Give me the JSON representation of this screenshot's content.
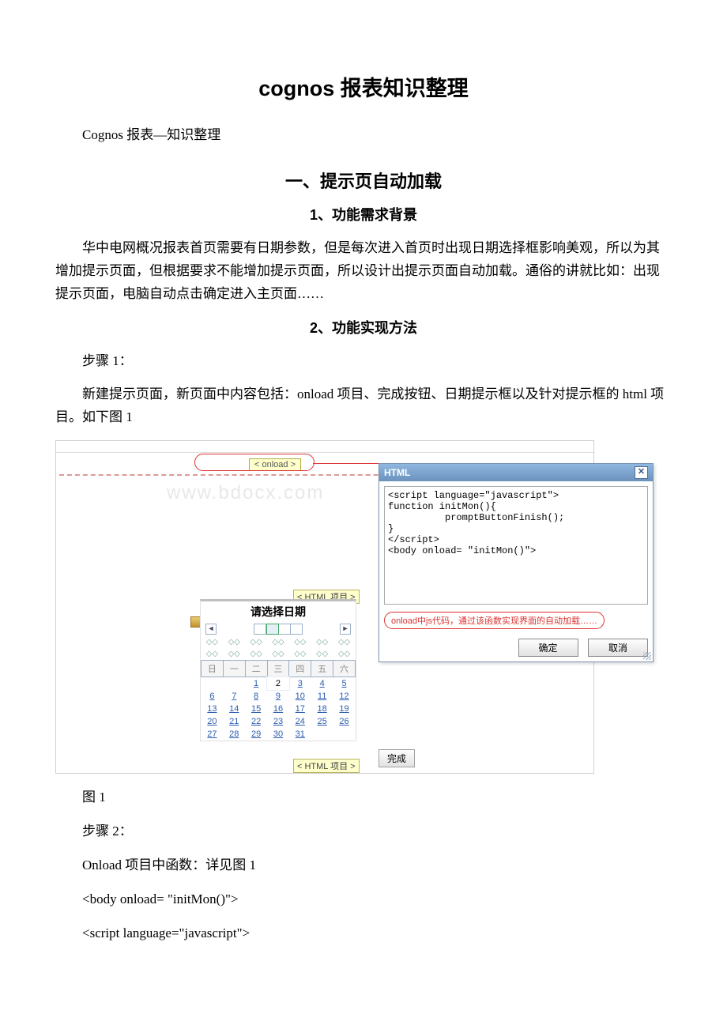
{
  "doc": {
    "title": "cognos 报表知识整理",
    "subtitle": "Cognos 报表—知识整理",
    "h1": "一、提示页自动加载",
    "s1_title": "1、功能需求背景",
    "s1_body": "华中电网概况报表首页需要有日期参数，但是每次进入首页时出现日期选择框影响美观，所以为其增加提示页面，但根据要求不能增加提示页面，所以设计出提示页面自动加载。通俗的讲就比如：出现提示页面，电脑自动点击确定进入主页面……",
    "s2_title": "2、功能实现方法",
    "step1_label": "步骤 1：",
    "step1_body": "新建提示页面，新页面中内容包括：onload 项目、完成按钮、日期提示框以及针对提示框的 html 项目。如下图 1",
    "fig_caption": "图 1",
    "step2_label": "步骤 2：",
    "step2_line1": "Onload 项目中函数：详见图 1",
    "step2_line2": "<body onload= \"initMon()\">",
    "step2_line3": "<script language=\"javascript\">"
  },
  "figure": {
    "watermark": "www.bdocx.com",
    "onload_pill": "< onload >",
    "html_item_label": "< HTML 项目 >",
    "calendar_title": "请选择日期",
    "nav_prev": "◄",
    "nav_next": "►",
    "dow": [
      "日",
      "一",
      "二",
      "三",
      "四",
      "五",
      "六"
    ],
    "arrow": "◇◇",
    "days": [
      [
        "",
        "",
        "1",
        "2",
        "3",
        "4",
        "5"
      ],
      [
        "6",
        "7",
        "8",
        "9",
        "10",
        "11",
        "12"
      ],
      [
        "13",
        "14",
        "15",
        "16",
        "17",
        "18",
        "19"
      ],
      [
        "20",
        "21",
        "22",
        "23",
        "24",
        "25",
        "26"
      ],
      [
        "27",
        "28",
        "29",
        "30",
        "31",
        "",
        ""
      ]
    ],
    "sel_day": "2",
    "finish": "完成",
    "dialog": {
      "title": "HTML",
      "close": "✕",
      "code": "<script language=\"javascript\">\nfunction initMon(){\n          promptButtonFinish();\n}\n</script>\n<body onload= \"initMon()\">",
      "note": "onload中js代码，通过该函数实现界面的自动加载……",
      "ok": "确定",
      "cancel": "取消"
    }
  }
}
